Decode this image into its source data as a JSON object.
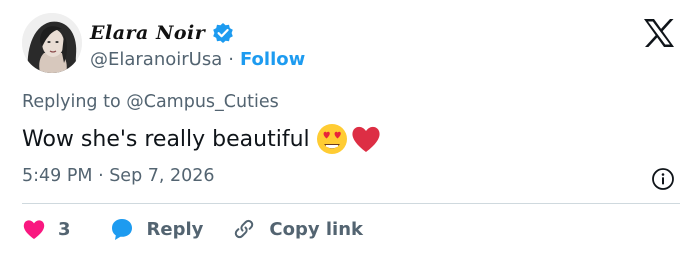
{
  "author": {
    "display_name": "Elara Noir",
    "handle": "@ElaranoirUsa",
    "separator": "·",
    "follow_label": "Follow"
  },
  "tweet": {
    "replying_to": "Replying to @Campus_Cuties",
    "text": "Wow she's really beautiful",
    "emojis": [
      "heart-eyes-emoji",
      "red-heart-emoji"
    ],
    "timestamp": "5:49 PM · Sep 7, 2026"
  },
  "actions": {
    "like_count": "3",
    "reply_label": "Reply",
    "copy_label": "Copy link"
  },
  "icons": [
    "verified-badge-icon",
    "x-logo-icon",
    "info-icon",
    "heart-icon",
    "reply-bubble-icon",
    "link-icon"
  ],
  "colors": {
    "accent": "#1d9bf0",
    "muted": "#536471",
    "text": "#0f1419",
    "like": "#f91880",
    "divider": "#cfd9de"
  }
}
